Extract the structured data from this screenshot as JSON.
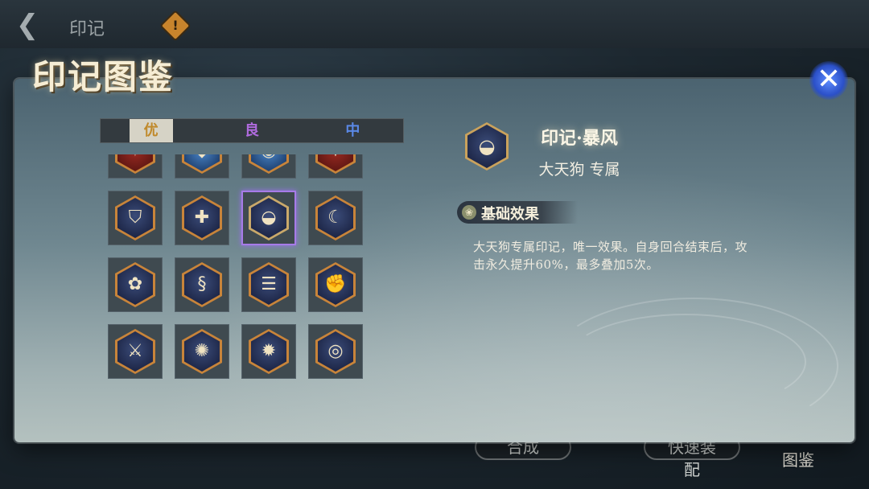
{
  "header": {
    "back_icon": "back-arrow-icon",
    "title": "印记",
    "warn_icon": "warning-icon",
    "warn_glyph": "!"
  },
  "modal": {
    "title": "印记图鉴",
    "close_glyph": "✕"
  },
  "tabs": [
    {
      "label": "优",
      "active": true
    },
    {
      "label": "良",
      "active": false
    },
    {
      "label": "中",
      "active": false
    }
  ],
  "grid": {
    "cells": [
      {
        "icon": "fire-mark-icon",
        "glyph": "✶",
        "tone": "red"
      },
      {
        "icon": "shield-aura-icon",
        "glyph": "◆",
        "tone": "blue"
      },
      {
        "icon": "water-orb-icon",
        "glyph": "◉",
        "tone": "blue"
      },
      {
        "icon": "flame-burst-icon",
        "glyph": "✸",
        "tone": "red"
      },
      {
        "icon": "shield-icon",
        "glyph": "⛉",
        "tone": ""
      },
      {
        "icon": "heart-heal-icon",
        "glyph": "✚",
        "tone": ""
      },
      {
        "icon": "fan-storm-icon",
        "glyph": "◒",
        "tone": "",
        "selected": true
      },
      {
        "icon": "crescent-blade-icon",
        "glyph": "☾",
        "tone": ""
      },
      {
        "icon": "flower-icon",
        "glyph": "✿",
        "tone": ""
      },
      {
        "icon": "dragon-icon",
        "glyph": "§",
        "tone": ""
      },
      {
        "icon": "scroll-talisman-icon",
        "glyph": "☰",
        "tone": ""
      },
      {
        "icon": "flexed-arm-icon",
        "glyph": "✊",
        "tone": ""
      },
      {
        "icon": "warrior-sword-icon",
        "glyph": "⚔",
        "tone": ""
      },
      {
        "icon": "splash-icon",
        "glyph": "✺",
        "tone": ""
      },
      {
        "icon": "wild-beast-icon",
        "glyph": "✹",
        "tone": ""
      },
      {
        "icon": "eye-orb-icon",
        "glyph": "◎",
        "tone": ""
      }
    ]
  },
  "detail": {
    "icon": "fan-storm-icon",
    "icon_glyph": "◒",
    "name": "印记·暴风",
    "owner": "大天狗 专属",
    "section_icon": "leaf-emblem-icon",
    "section_glyph": "❀",
    "section_title": "基础效果",
    "description": "大天狗专属印记，唯一效果。自身回合结束后，攻击永久提升60%，最多叠加5次。"
  },
  "bottom": {
    "craft_label": "合成",
    "quick_label": "快速装配",
    "codex_label": "图鉴"
  }
}
